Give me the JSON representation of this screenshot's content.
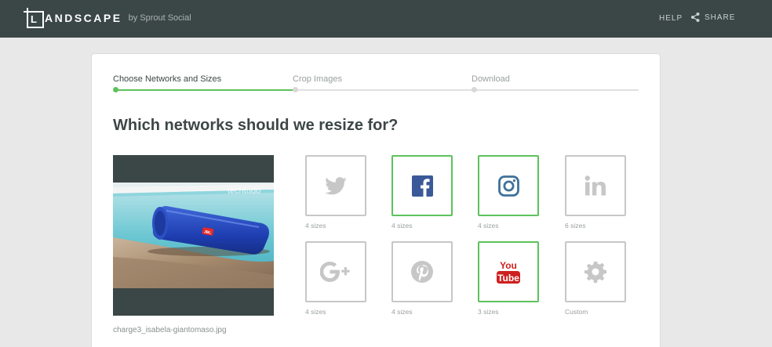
{
  "header": {
    "logo_letter": "L",
    "logo_word": "ANDSCAPE",
    "logo_by": "by Sprout Social",
    "help_label": "HELP",
    "share_label": "SHARE"
  },
  "steps": [
    {
      "label": "Choose Networks and Sizes",
      "state": "active"
    },
    {
      "label": "Crop Images",
      "state": "inactive"
    },
    {
      "label": "Download",
      "state": "inactive"
    }
  ],
  "heading": "Which networks should we resize for?",
  "preview": {
    "filename": "charge3_isabela-giantomaso.jpg",
    "watermark": "techtudo",
    "brand": "JBL"
  },
  "networks": [
    {
      "name": "Twitter",
      "icon": "twitter-icon",
      "caption": "4 sizes",
      "selected": false,
      "color": "#c7c7c7"
    },
    {
      "name": "Facebook",
      "icon": "facebook-icon",
      "caption": "4 sizes",
      "selected": true,
      "color": "#3b5998"
    },
    {
      "name": "Instagram",
      "icon": "instagram-icon",
      "caption": "4 sizes",
      "selected": true,
      "color": "#3f729b"
    },
    {
      "name": "LinkedIn",
      "icon": "linkedin-icon",
      "caption": "6 sizes",
      "selected": false,
      "color": "#c7c7c7"
    },
    {
      "name": "Google Plus",
      "icon": "google-plus-icon",
      "caption": "4 sizes",
      "selected": false,
      "color": "#c7c7c7"
    },
    {
      "name": "Pinterest",
      "icon": "pinterest-icon",
      "caption": "4 sizes",
      "selected": false,
      "color": "#c7c7c7"
    },
    {
      "name": "YouTube",
      "icon": "youtube-icon",
      "caption": "3 sizes",
      "selected": true,
      "color": "#cd201f",
      "icon_text_top": "You",
      "icon_text_bottom": "Tube"
    },
    {
      "name": "Custom",
      "icon": "gear-icon",
      "caption": "Custom",
      "selected": false,
      "color": "#c7c7c7"
    }
  ],
  "colors": {
    "topbar": "#3b4646",
    "accent_green": "#5cc25c"
  }
}
